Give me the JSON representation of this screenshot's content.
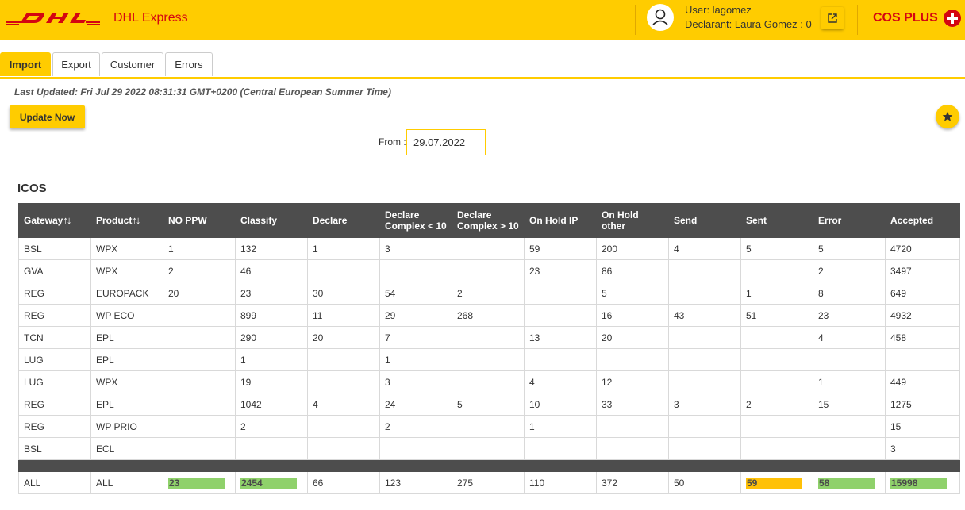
{
  "header": {
    "brand": "DHL Express",
    "user": "User: lagomez",
    "declarant": "Declarant: Laura Gomez : 0",
    "app_name": "COS PLUS",
    "colors": {
      "bar": "#ffcc00",
      "brand_red": "#d40511"
    }
  },
  "tabs": [
    "Import",
    "Export",
    "Customer",
    "Errors"
  ],
  "active_tab": "Import",
  "last_updated": "Last Updated: Fri Jul 29 2022 08:31:31 GMT+0200 (Central European Summer Time)",
  "update_button": "Update Now",
  "from": {
    "label": "From :",
    "value": "29.07.2022"
  },
  "section_title": "ICOS",
  "table": {
    "columns": [
      "Gateway",
      "Product",
      "NO PPW",
      "Classify",
      "Declare",
      "Declare Complex < 10",
      "Declare Complex > 10",
      "On Hold IP",
      "On Hold other",
      "Send",
      "Sent",
      "Error",
      "Accepted"
    ],
    "rows": [
      [
        "BSL",
        "WPX",
        "1",
        "132",
        "1",
        "3",
        "",
        "59",
        "200",
        "4",
        "5",
        "5",
        "4720"
      ],
      [
        "GVA",
        "WPX",
        "2",
        "46",
        "",
        "",
        "",
        "23",
        "86",
        "",
        "",
        "2",
        "3497"
      ],
      [
        "REG",
        "EUROPACK",
        "20",
        "23",
        "30",
        "54",
        "2",
        "",
        "5",
        "",
        "1",
        "8",
        "649"
      ],
      [
        "REG",
        "WP ECO",
        "",
        "899",
        "11",
        "29",
        "268",
        "",
        "16",
        "43",
        "51",
        "23",
        "4932"
      ],
      [
        "TCN",
        "EPL",
        "",
        "290",
        "20",
        "7",
        "",
        "13",
        "20",
        "",
        "",
        "4",
        "458"
      ],
      [
        "LUG",
        "EPL",
        "",
        "1",
        "",
        "1",
        "",
        "",
        "",
        "",
        "",
        "",
        ""
      ],
      [
        "LUG",
        "WPX",
        "",
        "19",
        "",
        "3",
        "",
        "4",
        "12",
        "",
        "",
        "1",
        "449"
      ],
      [
        "REG",
        "EPL",
        "",
        "1042",
        "4",
        "24",
        "5",
        "10",
        "33",
        "3",
        "2",
        "15",
        "1275"
      ],
      [
        "REG",
        "WP PRIO",
        "",
        "2",
        "",
        "2",
        "",
        "1",
        "",
        "",
        "",
        "",
        "15"
      ],
      [
        "BSL",
        "ECL",
        "",
        "",
        "",
        "",
        "",
        "",
        "",
        "",
        "",
        "",
        "3"
      ]
    ],
    "total": {
      "gateway": "ALL",
      "product": "ALL",
      "no_ppw": "23",
      "classify": "2454",
      "declare": "66",
      "dc_lt10": "123",
      "dc_gt10": "275",
      "on_hold_ip": "110",
      "on_hold_other": "372",
      "send": "50",
      "sent": "59",
      "error": "58",
      "accepted": "15998"
    },
    "status_colors": {
      "ok": "#8fd16b",
      "warn": "#ffc107"
    }
  }
}
